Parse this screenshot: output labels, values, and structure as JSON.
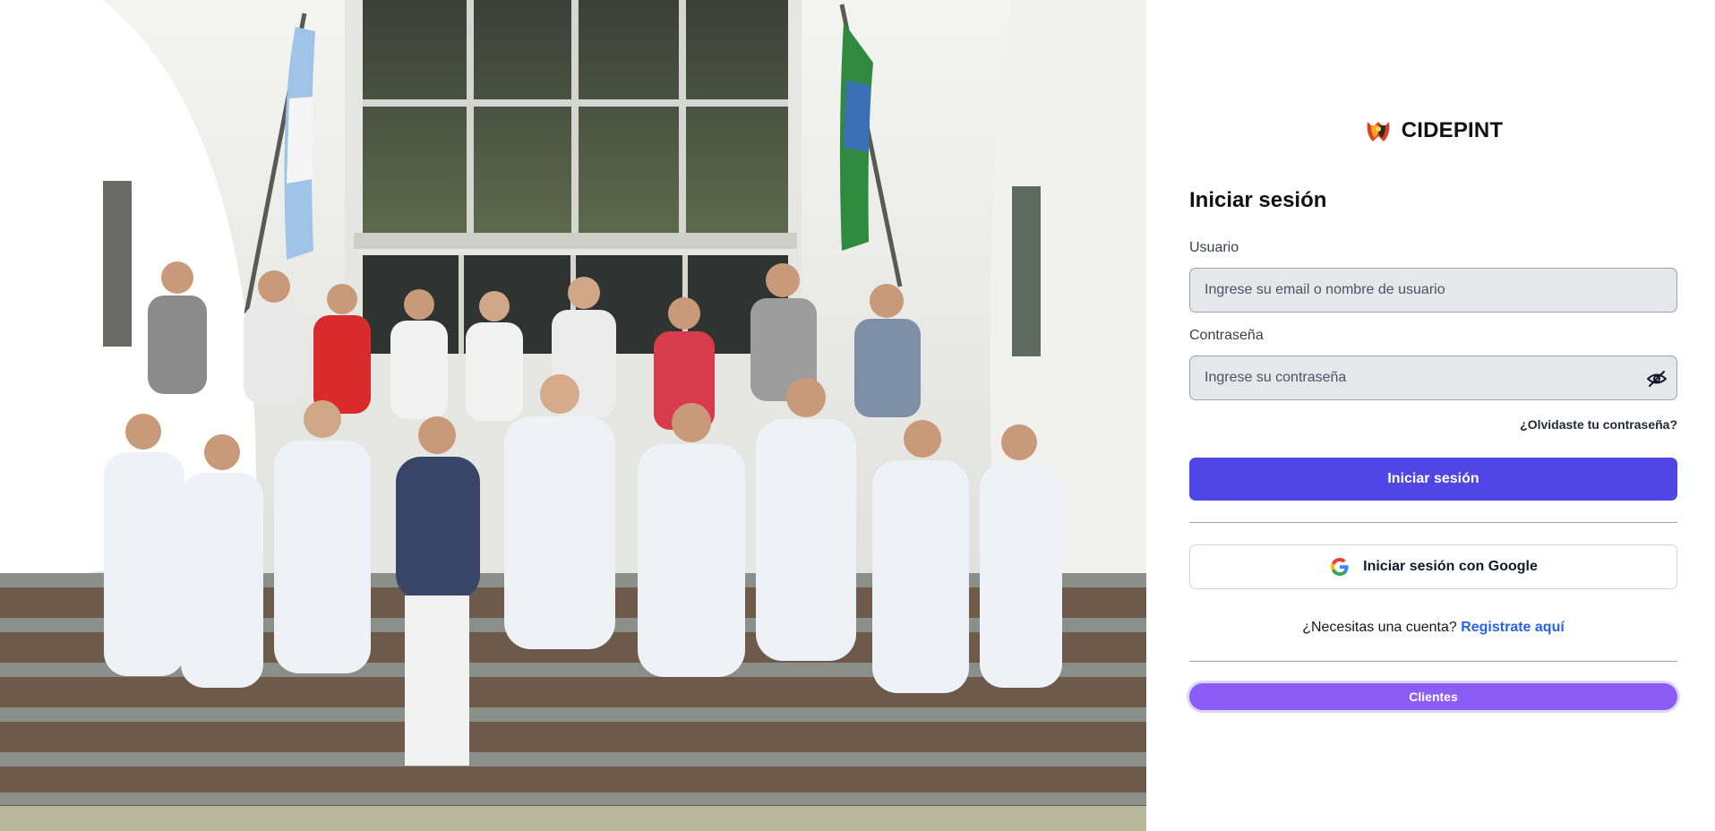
{
  "brand": {
    "name": "CIDEPINT",
    "logo_icon": "cidepint-logo-icon"
  },
  "login": {
    "title": "Iniciar sesión",
    "username_label": "Usuario",
    "username_placeholder": "Ingrese su email o nombre de usuario",
    "password_label": "Contraseña",
    "password_placeholder": "Ingrese su contraseña",
    "password_toggle_icon": "eye-off-icon",
    "forgot_password": "¿Olvidaste tu contraseña?",
    "submit_label": "Iniciar sesión",
    "google_label": "Iniciar sesión con Google",
    "google_icon": "google-icon",
    "signup_prompt": "¿Necesitas una cuenta?",
    "signup_link": "Registrate aquí",
    "clients_label": "Clientes"
  },
  "photo": {
    "description_icon": "group-photo"
  },
  "colors": {
    "primary": "#4f46e5",
    "clients": "#8b5cf6",
    "link": "#2563eb",
    "input_bg": "#e5e7eb"
  }
}
